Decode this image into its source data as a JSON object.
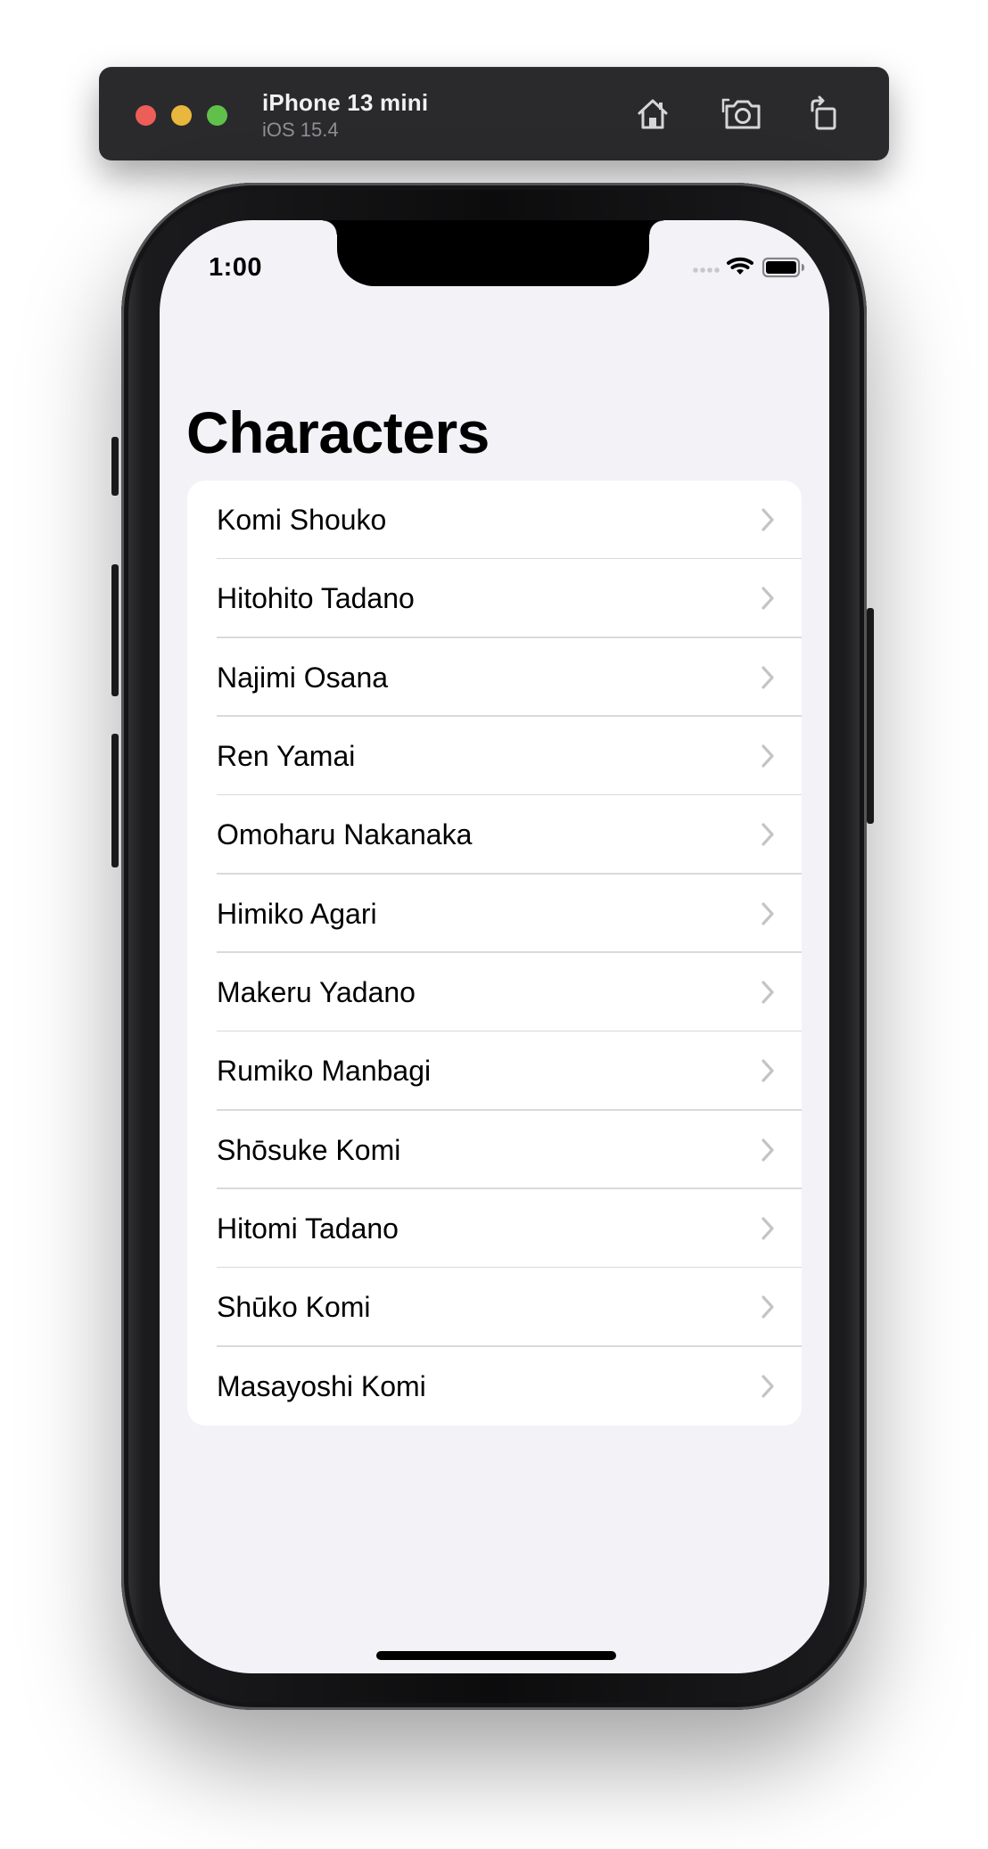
{
  "simulator": {
    "device_name": "iPhone 13 mini",
    "os_version": "iOS 15.4",
    "buttons": {
      "home": "home-icon",
      "screenshot": "camera-icon",
      "rotate": "rotate-icon"
    }
  },
  "status_bar": {
    "time": "1:00",
    "icons": [
      "cellular-dots-icon",
      "wifi-icon",
      "battery-icon"
    ]
  },
  "navigation": {
    "large_title": "Characters"
  },
  "list": {
    "rows": [
      {
        "label": "Komi Shouko"
      },
      {
        "label": "Hitohito Tadano"
      },
      {
        "label": "Najimi Osana"
      },
      {
        "label": "Ren Yamai"
      },
      {
        "label": "Omoharu Nakanaka"
      },
      {
        "label": "Himiko Agari"
      },
      {
        "label": "Makeru Yadano"
      },
      {
        "label": "Rumiko Manbagi"
      },
      {
        "label": "Shōsuke Komi"
      },
      {
        "label": "Hitomi Tadano"
      },
      {
        "label": "Shūko Komi"
      },
      {
        "label": "Masayoshi Komi"
      }
    ],
    "accessory_icon": "chevron-right-icon"
  },
  "colors": {
    "screen_background": "#f2f2f7",
    "card_background": "#ffffff",
    "separator": "#d9d9de",
    "chevron": "#c4c4c7",
    "toolbar_background": "#2a2a2c"
  }
}
